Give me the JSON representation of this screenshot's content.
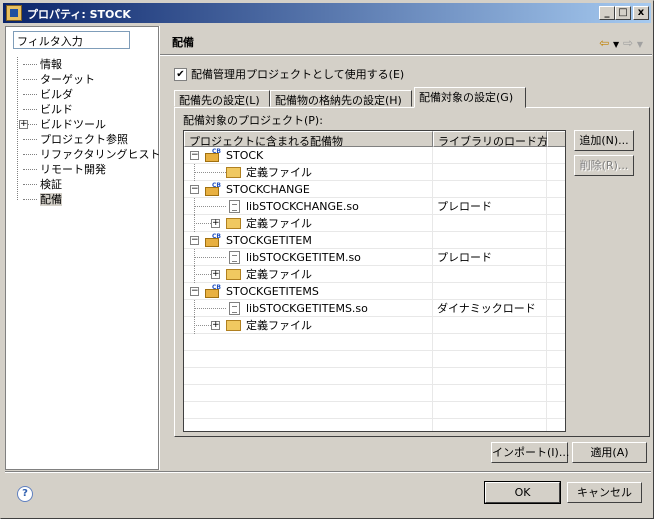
{
  "window": {
    "title": "プロパティ: STOCK",
    "minimize": "_",
    "maximize": "□",
    "close": "x"
  },
  "sidebar": {
    "filter_value": "フィルタ入力",
    "items": [
      {
        "label": "情報",
        "expandable": false
      },
      {
        "label": "ターゲット",
        "expandable": false
      },
      {
        "label": "ビルダ",
        "expandable": false
      },
      {
        "label": "ビルド",
        "expandable": false
      },
      {
        "label": "ビルドツール",
        "expandable": true
      },
      {
        "label": "プロジェクト参照",
        "expandable": false
      },
      {
        "label": "リファクタリングヒストリ",
        "expandable": false
      },
      {
        "label": "リモート開発",
        "expandable": false
      },
      {
        "label": "検証",
        "expandable": false
      },
      {
        "label": "配備",
        "expandable": false,
        "selected": true
      }
    ]
  },
  "main": {
    "title": "配備",
    "use_as_deploy_project": "配備管理用プロジェクトとして使用する(E)",
    "tabs": [
      {
        "label": "配備先の設定(L)"
      },
      {
        "label": "配備物の格納先の設定(H)"
      },
      {
        "label": "配備対象の設定(G)",
        "active": true
      }
    ],
    "group_label": "配備対象のプロジェクト(P):",
    "table": {
      "headers": [
        "プロジェクトに含まれる配備物",
        "ライブラリのロード方法"
      ],
      "rows": [
        {
          "kind": "project",
          "name": "STOCK",
          "expander": "−",
          "load": ""
        },
        {
          "kind": "folder",
          "name": "定義ファイル",
          "expander": "",
          "load": ""
        },
        {
          "kind": "project",
          "name": "STOCKCHANGE",
          "expander": "−",
          "load": ""
        },
        {
          "kind": "file",
          "name": "libSTOCKCHANGE.so",
          "expander": "",
          "load": "プレロード"
        },
        {
          "kind": "folder",
          "name": "定義ファイル",
          "expander": "+",
          "load": ""
        },
        {
          "kind": "project",
          "name": "STOCKGETITEM",
          "expander": "−",
          "load": ""
        },
        {
          "kind": "file",
          "name": "libSTOCKGETITEM.so",
          "expander": "",
          "load": "プレロード"
        },
        {
          "kind": "folder",
          "name": "定義ファイル",
          "expander": "+",
          "load": ""
        },
        {
          "kind": "project",
          "name": "STOCKGETITEMS",
          "expander": "−",
          "load": ""
        },
        {
          "kind": "file",
          "name": "libSTOCKGETITEMS.so",
          "expander": "",
          "load": "ダイナミックロード"
        },
        {
          "kind": "folder",
          "name": "定義ファイル",
          "expander": "+",
          "load": ""
        }
      ]
    },
    "add_button": "追加(N)...",
    "remove_button": "削除(R)...",
    "import_button": "インポート(I)...",
    "apply_button": "適用(A)"
  },
  "footer": {
    "help": "?",
    "ok": "OK",
    "cancel": "キャンセル"
  }
}
